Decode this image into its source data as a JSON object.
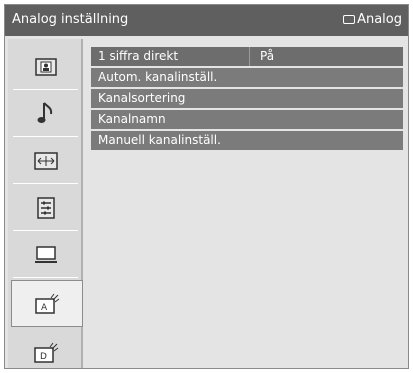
{
  "header": {
    "title": "Analog inställning",
    "source_label": "Analog"
  },
  "sidebar": {
    "items": [
      {
        "icon": "picture-icon"
      },
      {
        "icon": "music-note-icon"
      },
      {
        "icon": "screen-icon"
      },
      {
        "icon": "settings-list-icon"
      },
      {
        "icon": "monitor-icon"
      },
      {
        "icon": "analog-tv-setup-icon"
      },
      {
        "icon": "digital-tv-setup-icon"
      }
    ]
  },
  "menu": {
    "items": [
      {
        "label": "1 siffra direkt",
        "value": "På"
      },
      {
        "label": "Autom. kanalinställ."
      },
      {
        "label": "Kanalsortering"
      },
      {
        "label": "Kanalnamn"
      },
      {
        "label": "Manuell kanalinställ."
      }
    ]
  }
}
